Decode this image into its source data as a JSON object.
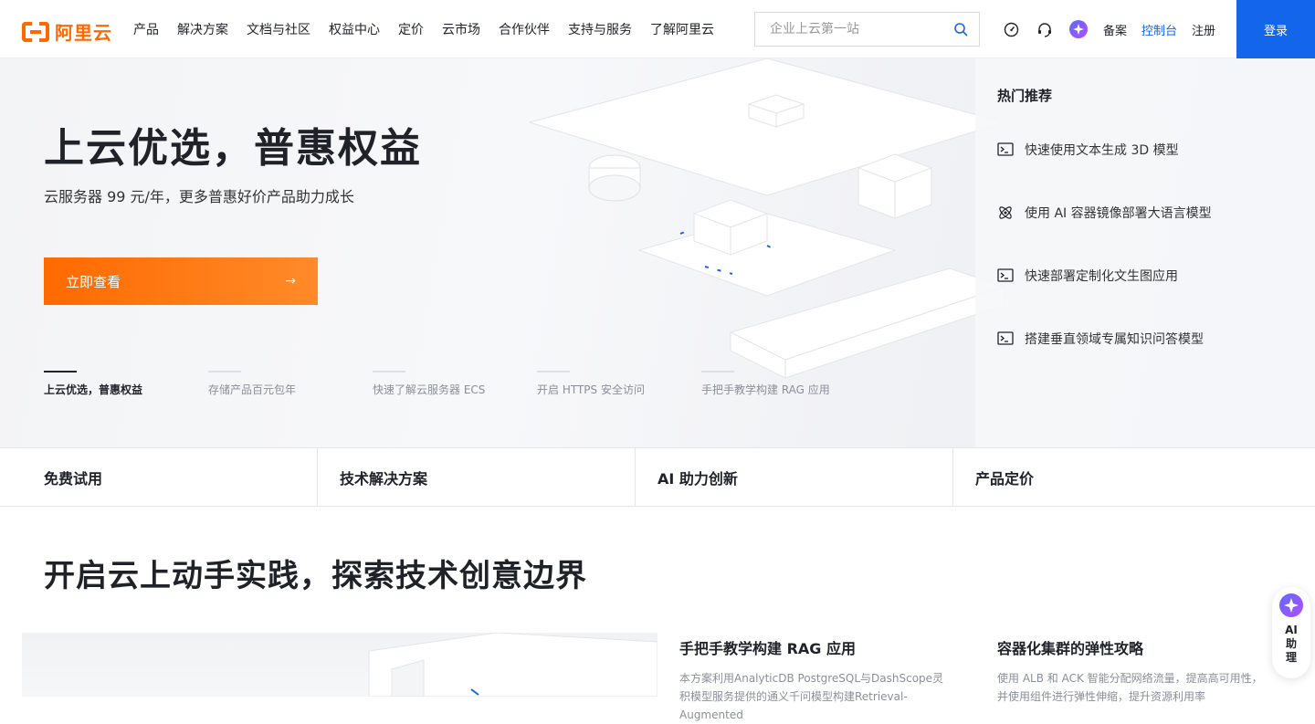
{
  "brand": {
    "name": "阿里云",
    "color": "#ff6a00"
  },
  "nav": [
    "产品",
    "解决方案",
    "文档与社区",
    "权益中心",
    "定价",
    "云市场",
    "合作伙伴",
    "支持与服务",
    "了解阿里云"
  ],
  "search": {
    "placeholder": "企业上云第一站"
  },
  "tools": {
    "record": "备案",
    "console": "控制台",
    "register": "注册",
    "login": "登录",
    "login_color": "#1366ec"
  },
  "hero": {
    "title": "上云优选，普惠权益",
    "subtitle": "云服务器 99 元/年，更多普惠好价产品助力成长",
    "button": "立即查看",
    "tabs": [
      "上云优选，普惠权益",
      "存储产品百元包年",
      "快速了解云服务器 ECS",
      "开启 HTTPS 安全访问",
      "手把手教学构建 RAG 应用"
    ],
    "active_tab": 0
  },
  "hot": {
    "title": "热门推荐",
    "items": [
      {
        "icon": "terminal-icon",
        "label": "快速使用文本生成 3D 模型"
      },
      {
        "icon": "ai-model-icon",
        "label": "使用 AI 容器镜像部署大语言模型"
      },
      {
        "icon": "terminal-icon",
        "label": "快速部署定制化文生图应用"
      },
      {
        "icon": "terminal-icon",
        "label": "搭建垂直领域专属知识问答模型"
      }
    ]
  },
  "categories": [
    "免费试用",
    "技术解决方案",
    "AI 助力创新",
    "产品定价"
  ],
  "section": {
    "title": "开启云上动手实践，探索技术创意边界",
    "cards": [
      {
        "title": "手把手教学构建 RAG 应用",
        "desc": "本方案利用AnalyticDB PostgreSQL与DashScope灵积模型服务提供的通义千问模型构建Retrieval-Augmented"
      },
      {
        "title": "容器化集群的弹性攻略",
        "desc": "使用 ALB 和 ACK 智能分配网络流量，提高高可用性，并使用组件进行弹性伸缩，提升资源利用率"
      }
    ]
  },
  "ai_assistant": {
    "label": "AI助理"
  }
}
